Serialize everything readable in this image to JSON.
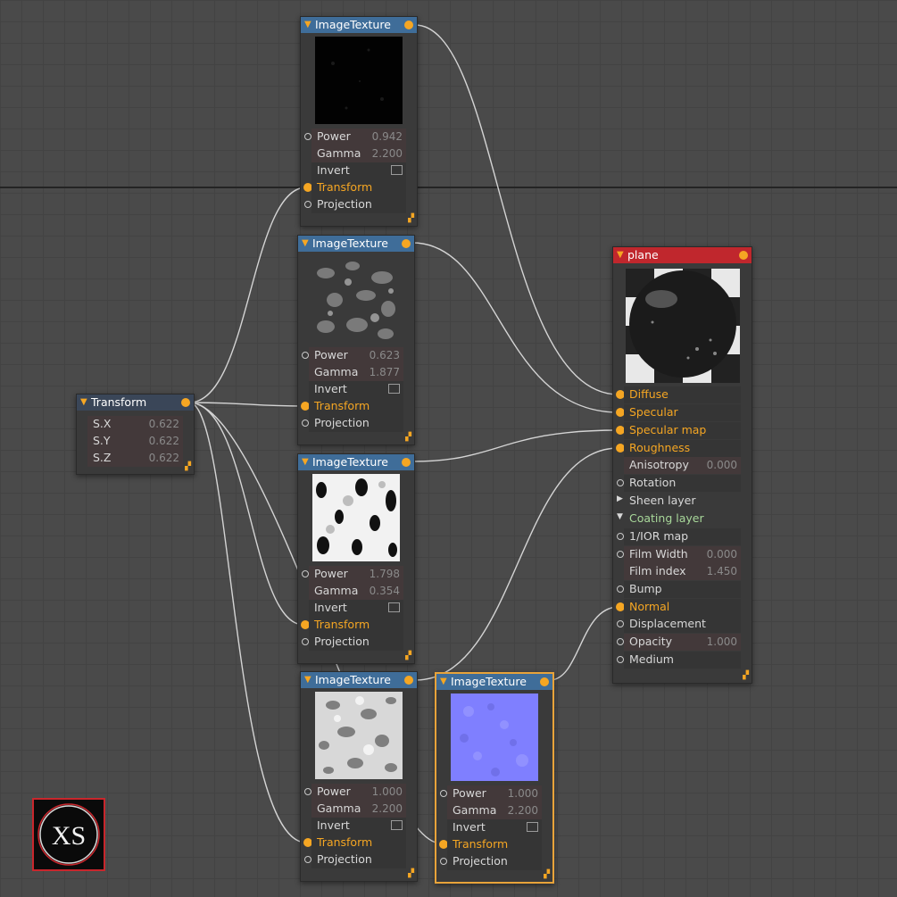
{
  "image_texture_nodes": [
    {
      "title": "ImageTexture",
      "power_label": "Power",
      "power": "0.942",
      "gamma_label": "Gamma",
      "gamma": "2.200",
      "invert_label": "Invert",
      "transform_label": "Transform",
      "projection_label": "Projection",
      "thumb": "dark"
    },
    {
      "title": "ImageTexture",
      "power_label": "Power",
      "power": "0.623",
      "gamma_label": "Gamma",
      "gamma": "1.877",
      "invert_label": "Invert",
      "transform_label": "Transform",
      "projection_label": "Projection",
      "thumb": "gray-noise"
    },
    {
      "title": "ImageTexture",
      "power_label": "Power",
      "power": "1.798",
      "gamma_label": "Gamma",
      "gamma": "0.354",
      "invert_label": "Invert",
      "transform_label": "Transform",
      "projection_label": "Projection",
      "thumb": "white-black-blobs"
    },
    {
      "title": "ImageTexture",
      "power_label": "Power",
      "power": "1.000",
      "gamma_label": "Gamma",
      "gamma": "2.200",
      "invert_label": "Invert",
      "transform_label": "Transform",
      "projection_label": "Projection",
      "thumb": "light-noise"
    },
    {
      "title": "ImageTexture",
      "power_label": "Power",
      "power": "1.000",
      "gamma_label": "Gamma",
      "gamma": "2.200",
      "invert_label": "Invert",
      "transform_label": "Transform",
      "projection_label": "Projection",
      "thumb": "normal-map"
    }
  ],
  "transform_node": {
    "title": "Transform",
    "rows": [
      {
        "label": "S.X",
        "value": "0.622"
      },
      {
        "label": "S.Y",
        "value": "0.622"
      },
      {
        "label": "S.Z",
        "value": "0.622"
      }
    ]
  },
  "plane_node": {
    "title": "plane",
    "rows": [
      {
        "label": "Diffuse",
        "value": ""
      },
      {
        "label": "Specular",
        "value": ""
      },
      {
        "label": "Specular map",
        "value": ""
      },
      {
        "label": "Roughness",
        "value": ""
      },
      {
        "label": "Anisotropy",
        "value": "0.000"
      },
      {
        "label": "Rotation",
        "value": ""
      },
      {
        "label": "Sheen layer",
        "value": ""
      },
      {
        "label": "Coating layer",
        "value": ""
      },
      {
        "label": "1/IOR map",
        "value": ""
      },
      {
        "label": "Film Width",
        "value": "0.000"
      },
      {
        "label": "Film index",
        "value": "1.450"
      },
      {
        "label": "Bump",
        "value": ""
      },
      {
        "label": "Normal",
        "value": ""
      },
      {
        "label": "Displacement",
        "value": ""
      },
      {
        "label": "Opacity",
        "value": "1.000"
      },
      {
        "label": "Medium",
        "value": ""
      }
    ]
  },
  "logo": {
    "text": "XS"
  },
  "colors": {
    "port_linked": "#f5a623",
    "texture_header": "#3f6d99",
    "plane_header": "#c0272d",
    "selected_border": "#e8a33a",
    "wire": "#d4d4d4"
  },
  "icons": {
    "collapse": "triangle-down-icon",
    "resize": "resize-grip-icon",
    "port": "socket-icon"
  }
}
